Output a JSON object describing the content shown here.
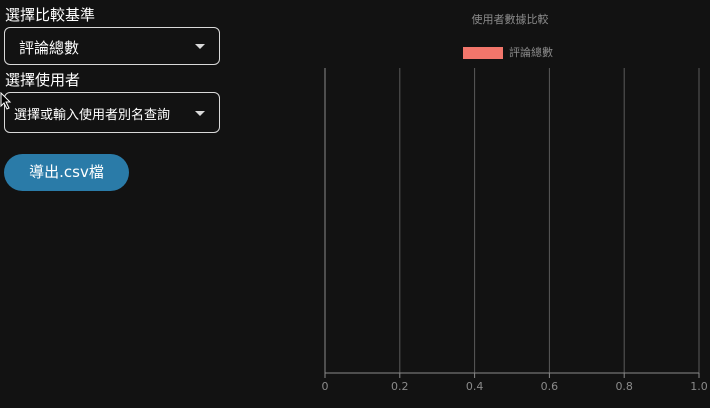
{
  "controls": {
    "compare_label": "選擇比較基準",
    "compare_value": "評論總數",
    "user_label": "選擇使用者",
    "user_placeholder": "選擇或輸入使用者別名查詢",
    "export_label": "導出.csv檔"
  },
  "chart_data": {
    "type": "bar",
    "title": "使用者數據比較",
    "series": [
      {
        "name": "評論總數",
        "values": [],
        "color": "#f2766b"
      }
    ],
    "categories": [],
    "xlim": [
      0,
      1
    ],
    "xticks": [
      "0",
      "0.2",
      "0.4",
      "0.6",
      "0.8",
      "1.0"
    ],
    "grid": true,
    "legend": "top"
  },
  "colors": {
    "background": "#121212",
    "button": "#2a7ba8",
    "series": "#f2766b",
    "grid": "#5a5a5a"
  }
}
